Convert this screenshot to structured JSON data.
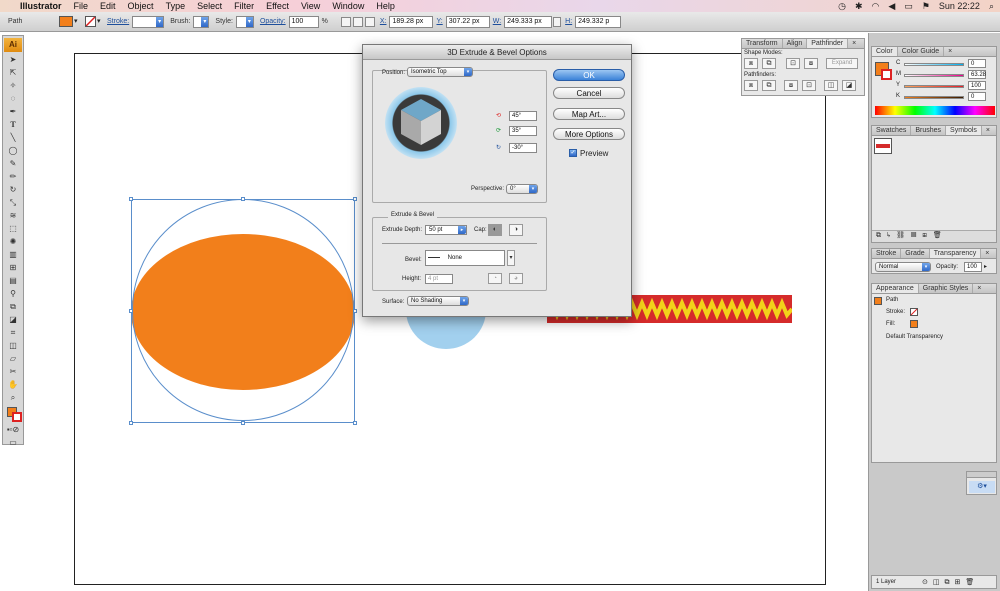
{
  "menubar": {
    "apple_glyph": "",
    "app_name": "Illustrator",
    "items": [
      "File",
      "Edit",
      "Object",
      "Type",
      "Select",
      "Filter",
      "Effect",
      "View",
      "Window",
      "Help"
    ],
    "clock": "Sun 22:22"
  },
  "controlbar": {
    "selection_label": "Path",
    "fill_color": "#f27f1b",
    "stroke_label": "Stroke:",
    "brush_label": "Brush:",
    "style_label": "Style:",
    "opacity_label": "Opacity:",
    "opacity_value": "100",
    "opacity_unit": "%",
    "x_label": "X:",
    "x_value": "189.28 px",
    "y_label": "Y:",
    "y_value": "307.22 px",
    "w_label": "W:",
    "w_value": "249.333 px",
    "h_label": "H:",
    "h_value": "249.332 p"
  },
  "toolbox": {
    "badge": "Ai",
    "tools": [
      "selection",
      "direct-selection",
      "magic-wand",
      "lasso",
      "pen",
      "type",
      "line",
      "ellipse",
      "paintbrush",
      "pencil",
      "rotate",
      "scale",
      "warp",
      "free-transform",
      "symbol-sprayer",
      "column-graph",
      "mesh",
      "gradient",
      "eyedropper",
      "blend",
      "live-paint",
      "live-paint-selection",
      "crop",
      "slice",
      "eraser",
      "scissors",
      "hand",
      "zoom"
    ]
  },
  "dialog": {
    "title": "3D Extrude & Bevel Options",
    "position_label": "Position:",
    "position_value": "Isometric Top",
    "rot_x": "45°",
    "rot_y": "35°",
    "rot_z": "-30°",
    "perspective_label": "Perspective:",
    "perspective_value": "0°",
    "extrude_group_label": "Extrude & Bevel",
    "extrude_depth_label": "Extrude Depth:",
    "extrude_depth_value": "50 pt",
    "cap_label": "Cap:",
    "bevel_label": "Bevel:",
    "bevel_value": "None",
    "height_label": "Height:",
    "height_value": "4 pt",
    "surface_label": "Surface:",
    "surface_value": "No Shading",
    "ok_label": "OK",
    "cancel_label": "Cancel",
    "map_art_label": "Map Art...",
    "more_options_label": "More Options",
    "preview_label": "Preview",
    "preview_checked": true
  },
  "pathfinder_panel": {
    "tabs": [
      "Transform",
      "Align",
      "Pathfinder"
    ],
    "shape_modes_label": "Shape Modes:",
    "expand_label": "Expand",
    "pathfinders_label": "Pathfinders:"
  },
  "color_panel": {
    "tabs": [
      "Color",
      "Color Guide"
    ],
    "channels": [
      {
        "name": "C",
        "value": "0"
      },
      {
        "name": "M",
        "value": "63.28"
      },
      {
        "name": "Y",
        "value": "100"
      },
      {
        "name": "K",
        "value": "0"
      }
    ]
  },
  "swatches_panel": {
    "tabs": [
      "Swatches",
      "Brushes",
      "Symbols"
    ]
  },
  "transparency_panel": {
    "tabs": [
      "Stroke",
      "Grade",
      "Transparency"
    ],
    "blend_mode": "Normal",
    "opacity_label": "Opacity:",
    "opacity_value": "100"
  },
  "appearance_panel": {
    "tabs": [
      "Appearance",
      "Graphic Styles"
    ],
    "header": "Path",
    "stroke_label": "Stroke:",
    "fill_label": "Fill:",
    "default_transparency": "Default Transparency"
  },
  "layers_panel": {
    "count_label": "1 Layer"
  },
  "colors": {
    "fill_orange": "#f27f1b",
    "light_blue": "#a2d0ee",
    "zigzag_red": "#d52b2b",
    "zigzag_yellow": "#f2d21a",
    "selection_blue": "#5a8ecb"
  }
}
